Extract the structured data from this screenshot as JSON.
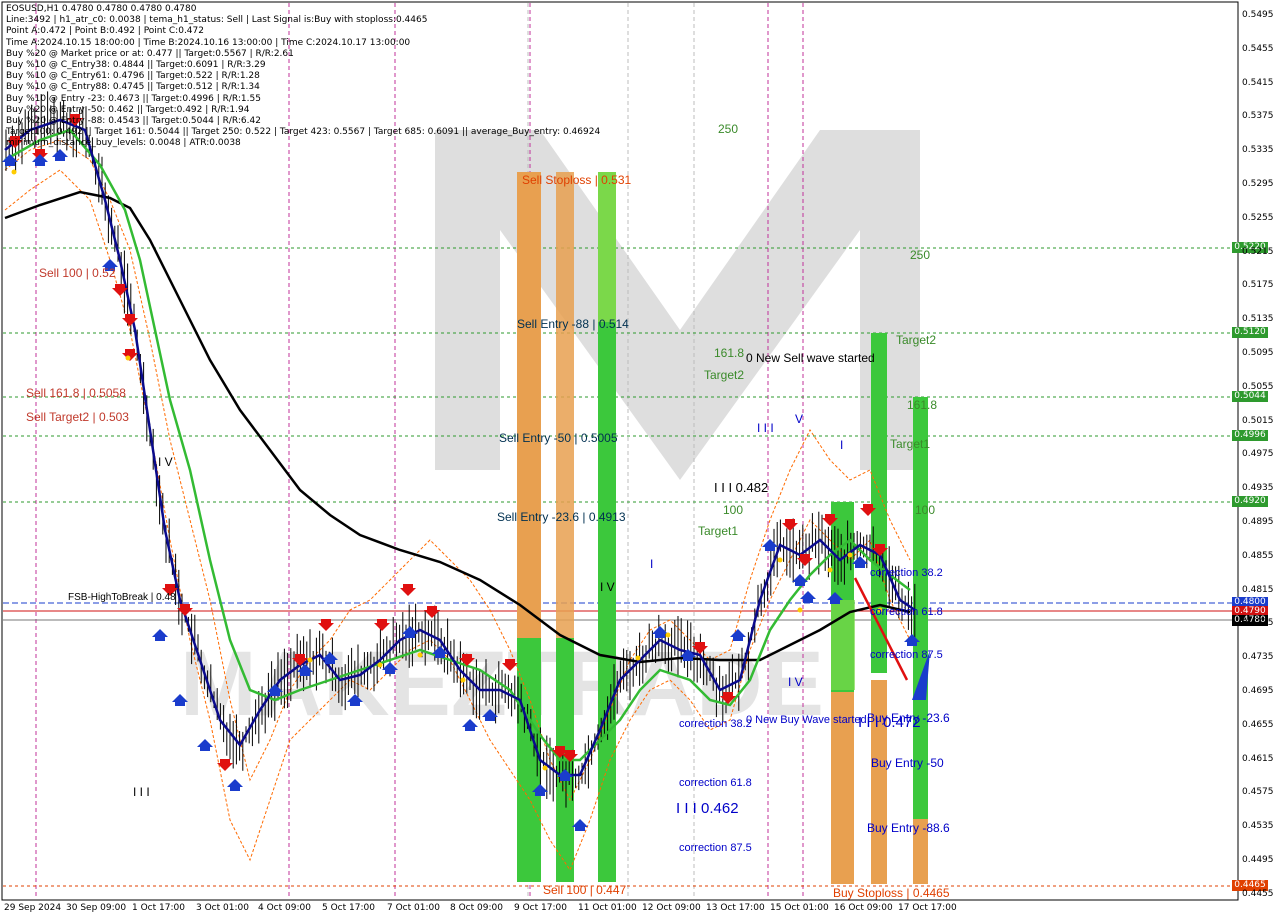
{
  "info": {
    "symbol": "EOSUSD,H1  0.4780 0.4780 0.4780 0.4780",
    "lines": [
      "Line:3492 | h1_atr_c0: 0.0038 | tema_h1_status: Sell | Last Signal is:Buy with stoploss:0.4465",
      "Point A:0.472 | Point B:0.492 | Point C:0.472",
      "Time A:2024.10.15 18:00:00 | Time B:2024.10.16 13:00:00 | Time C:2024.10.17 13:00:00",
      "Buy %20 @ Market price or at: 0.477 || Target:0.5567 | R/R:2.61",
      "Buy %10 @ C_Entry38: 0.4844 || Target:0.6091 | R/R:3.29",
      "Buy %10 @ C_Entry61: 0.4796 || Target:0.522 | R/R:1.28",
      "Buy %10 @ C_Entry88: 0.4745 || Target:0.512 | R/R:1.34",
      "Buy %10 @ Entry -23: 0.4673 || Target:0.4996 | R/R:1.55",
      "Buy %20 @ Entry -50: 0.462 || Target:0.492 | R/R:1.94",
      "Buy %20 @ Entry -88: 0.4543 || Target:0.5044 | R/R:6.42",
      "Target100: 0.492 || Target 161: 0.5044 || Target 250: 0.522 | Target 423: 0.5567 | Target 685: 0.6091 || average_Buy_entry: 0.46924",
      "minimum_distance_buy_levels: 0.0048 | ATR:0.0038"
    ]
  },
  "colors": {
    "sell_orange": "#e88a4a",
    "sell_green": "#3cc83c",
    "level_green": "#2e9a2e",
    "price_blue": "#1a3ccc",
    "price_red": "#d01010",
    "ma_black": "#000000",
    "ma_green": "#33bb33",
    "ma_navy": "#0a0a8c"
  },
  "labels": {
    "sell_stoploss": "Sell Stoploss | 0.531",
    "sell_entry_88": "Sell Entry -88 | 0.514",
    "sell_entry_50": "Sell Entry -50 | 0.5005",
    "sell_entry_23": "Sell Entry -23.6 | 0.4913",
    "sell_100_bottom": "Sell 100 | 0.447",
    "sell_100_left": "Sell 100 | 0.52",
    "sell_161_left": "Sell 161.8 | 0.5058",
    "sell_target2_left": "Sell Target2 | 0.503",
    "fsb": "FSB-HighToBreak | 0.48",
    "iv_left": "I V",
    "iv_mid": "I V",
    "i_mid": "I",
    "iii_left": "I I I",
    "l250_a": "250",
    "l250_b": "250",
    "l161_a": "161.8",
    "l161_b": "161.8",
    "target2_a": "Target2",
    "target2_b": "Target2",
    "target1_a": "Target1",
    "target1_b": "Target1",
    "l100_a": "100",
    "l100_b": "100",
    "new_sell_wave": "0 New Sell wave started",
    "new_buy_wave": "0 New Buy Wave started",
    "iii_0482": "I I I 0.482",
    "iii_top": "I I I",
    "v_top": "V",
    "i_top": "I",
    "iii_0462": "I I I 0.462",
    "iii_0472": "I I I 0.472",
    "iv_right": "I V",
    "corr_382_left": "correction 38.2",
    "corr_618_left": "correction 61.8",
    "corr_875_left": "correction 87.5",
    "corr_382_right": "correction 38.2",
    "corr_618_right": "correction 61.8",
    "corr_875_right": "correction 87.5",
    "buy_entry_236": "Buy Entry -23.6",
    "buy_entry_50": "Buy Entry -50",
    "buy_entry_88": "Buy Entry -88.6",
    "buy_stoploss": "Buy Stoploss | 0.4465"
  },
  "price_labels": [
    {
      "value": "0.5220",
      "color": "#2e9a2e"
    },
    {
      "value": "0.5120",
      "color": "#2e9a2e"
    },
    {
      "value": "0.5044",
      "color": "#2e9a2e"
    },
    {
      "value": "0.4996",
      "color": "#2e9a2e"
    },
    {
      "value": "0.4920",
      "color": "#2e9a2e"
    },
    {
      "value": "0.4800",
      "color": "#1a3ccc"
    },
    {
      "value": "0.4790",
      "color": "#d01010"
    },
    {
      "value": "0.4780",
      "color": "#000000"
    },
    {
      "value": "0.4465",
      "color": "#e04000"
    }
  ],
  "y_axis": [
    "0.5495",
    "0.5455",
    "0.5415",
    "0.5375",
    "0.5335",
    "0.5295",
    "0.5255",
    "0.5215",
    "0.5175",
    "0.5135",
    "0.5095",
    "0.5055",
    "0.5015",
    "0.4975",
    "0.4935",
    "0.4895",
    "0.4855",
    "0.4815",
    "0.4775",
    "0.4735",
    "0.4695",
    "0.4655",
    "0.4615",
    "0.4575",
    "0.4535",
    "0.4495",
    "0.4455"
  ],
  "x_axis": [
    "29 Sep 2024",
    "30 Sep 09:00",
    "1 Oct 17:00",
    "3 Oct 01:00",
    "4 Oct 09:00",
    "5 Oct 17:00",
    "7 Oct 01:00",
    "8 Oct 09:00",
    "9 Oct 17:00",
    "11 Oct 01:00",
    "12 Oct 09:00",
    "13 Oct 17:00",
    "15 Oct 01:00",
    "16 Oct 09:00",
    "17 Oct 17:00"
  ],
  "watermark": "MAKEZTRADE"
}
